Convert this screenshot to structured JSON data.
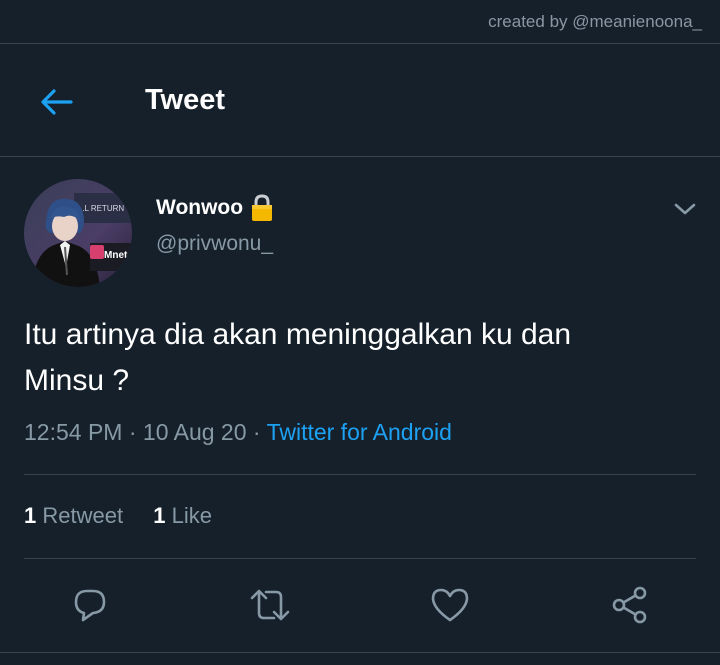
{
  "watermark": "created by @meanienoona_",
  "header": {
    "title": "Tweet",
    "back_icon": "arrow-left-icon"
  },
  "tweet": {
    "display_name": "Wonwoo",
    "handle": "@privwonu_",
    "locked_icon": "lock-icon",
    "text_line1": "Itu artinya dia akan meninggalkan ku dan",
    "text_line2": "Minsu ?",
    "time": "12:54 PM",
    "dot1": "·",
    "date": "10 Aug 20",
    "dot2": "·",
    "source": "Twitter for Android",
    "avatar_text": {
      "banner": "..L RETURN",
      "brand": "Mnet"
    }
  },
  "stats": {
    "retweets_count": "1",
    "retweets_label": "Retweet",
    "likes_count": "1",
    "likes_label": "Like"
  },
  "actions": [
    "reply-icon",
    "retweet-icon",
    "like-icon",
    "share-icon"
  ],
  "colors": {
    "background": "#15202b",
    "accent": "#1da1f2",
    "secondary_text": "#8899a6",
    "divider": "#38444d",
    "lock": "#f5b800"
  }
}
